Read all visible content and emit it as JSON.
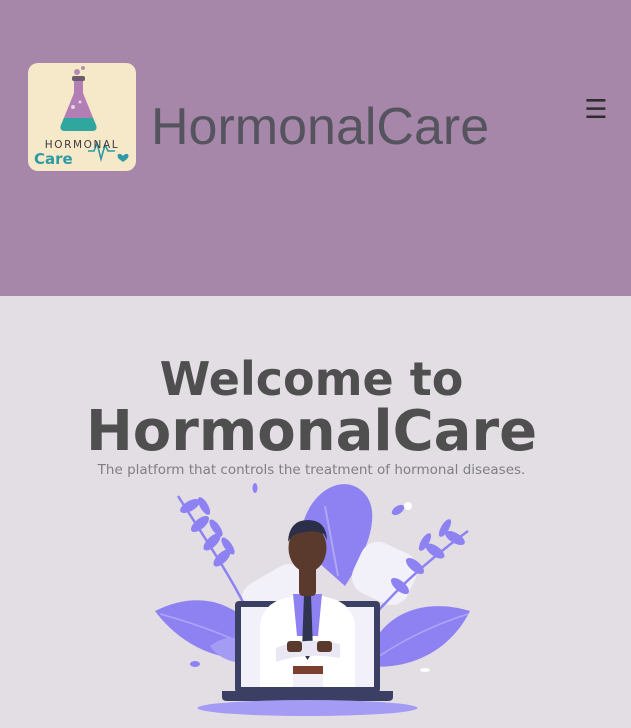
{
  "header": {
    "brand": "HormonalCare",
    "menu_icon": "☰",
    "logo": {
      "top_text": "HORMONAL",
      "bottom_text": "Care"
    }
  },
  "hero": {
    "line1": "Welcome to",
    "line2": "HormonalCare",
    "subtitle": "The platform that controls the treatment of hormonal diseases."
  },
  "colors": {
    "header_bg": "#a787a9",
    "page_bg": "#e3dde4",
    "accent_purple": "#8f83f2",
    "logo_teal": "#2f9aa4"
  }
}
